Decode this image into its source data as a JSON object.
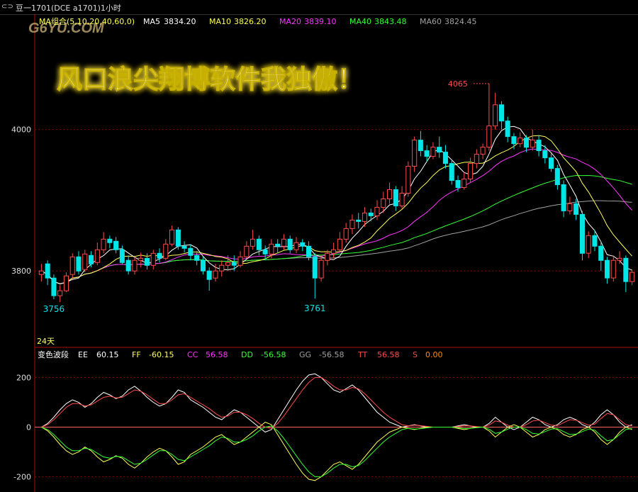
{
  "window": {
    "title": "豆一1701(DCE a1701)1小时"
  },
  "watermark": "G6YU.COM",
  "banner": "风口浪尖翔博软件我独傲！",
  "colors": {
    "up": "#ff4a4a",
    "down": "#00e5e5",
    "ma5": "#ffffff",
    "ma10": "#ffff55",
    "ma20": "#ff33ff",
    "ma40": "#33ff33",
    "ma60": "#a0a0a0",
    "grid": "#8a0000"
  },
  "price_panel": {
    "indicator_name": "MA组合(5,10,20,40,60,0)",
    "ma": [
      {
        "label": "MA5",
        "value": "3834.20",
        "color": "#ffffff"
      },
      {
        "label": "MA10",
        "value": "3826.20",
        "color": "#ffff55"
      },
      {
        "label": "MA20",
        "value": "3839.10",
        "color": "#ff33ff"
      },
      {
        "label": "MA40",
        "value": "3843.48",
        "color": "#33ff33"
      },
      {
        "label": "MA60",
        "value": "3824.45",
        "color": "#a0a0a0"
      }
    ],
    "period_label": "24天"
  },
  "indicator_panel": {
    "name": "变色波段",
    "values": [
      {
        "label": "EE",
        "value": "60.15",
        "label_color": "#ffffff",
        "value_color": "#ffffff"
      },
      {
        "label": "FF",
        "value": "-60.15",
        "label_color": "#ffff55",
        "value_color": "#ffff55"
      },
      {
        "label": "CC",
        "value": "56.58",
        "label_color": "#ff33ff",
        "value_color": "#ff33ff"
      },
      {
        "label": "DD",
        "value": "-56.58",
        "label_color": "#33ff33",
        "value_color": "#33ff33"
      },
      {
        "label": "GG",
        "value": "-56.58",
        "label_color": "#a0a0a0",
        "value_color": "#a0a0a0"
      },
      {
        "label": "TT",
        "value": "56.58",
        "label_color": "#ff4a4a",
        "value_color": "#ff4a4a"
      },
      {
        "label": "S",
        "value": "0.00",
        "label_color": "#ff4a4a",
        "value_color": "#ff8800"
      }
    ]
  },
  "chart_data": [
    {
      "type": "candlestick",
      "title": "豆一1701(DCE a1701)1小时",
      "ylabel": "",
      "y_ticks": [
        3800,
        4000
      ],
      "ylim": [
        3712,
        4133
      ],
      "annotations": [
        {
          "text": "4065",
          "index": 72,
          "kind": "high"
        },
        {
          "text": "3756",
          "index": 2,
          "kind": "low"
        },
        {
          "text": "3761",
          "index": 44,
          "kind": "low"
        }
      ],
      "candles": [
        [
          3795,
          3800,
          3785,
          3810
        ],
        [
          3810,
          3790,
          3780,
          3815
        ],
        [
          3790,
          3765,
          3760,
          3795
        ],
        [
          3765,
          3772,
          3756,
          3780
        ],
        [
          3772,
          3793,
          3770,
          3798
        ],
        [
          3795,
          3820,
          3790,
          3825
        ],
        [
          3820,
          3800,
          3795,
          3828
        ],
        [
          3802,
          3824,
          3798,
          3830
        ],
        [
          3822,
          3810,
          3805,
          3828
        ],
        [
          3812,
          3830,
          3808,
          3840
        ],
        [
          3830,
          3845,
          3825,
          3855
        ],
        [
          3845,
          3840,
          3832,
          3850
        ],
        [
          3842,
          3830,
          3825,
          3848
        ],
        [
          3830,
          3812,
          3810,
          3836
        ],
        [
          3815,
          3800,
          3795,
          3822
        ],
        [
          3800,
          3815,
          3795,
          3820
        ],
        [
          3815,
          3818,
          3805,
          3826
        ],
        [
          3818,
          3808,
          3802,
          3825
        ],
        [
          3808,
          3825,
          3802,
          3830
        ],
        [
          3825,
          3818,
          3812,
          3832
        ],
        [
          3818,
          3838,
          3815,
          3845
        ],
        [
          3838,
          3858,
          3835,
          3864
        ],
        [
          3858,
          3835,
          3830,
          3862
        ],
        [
          3835,
          3832,
          3826,
          3842
        ],
        [
          3832,
          3822,
          3815,
          3838
        ],
        [
          3822,
          3815,
          3808,
          3828
        ],
        [
          3815,
          3800,
          3795,
          3820
        ],
        [
          3800,
          3788,
          3772,
          3805
        ],
        [
          3790,
          3800,
          3785,
          3810
        ],
        [
          3800,
          3808,
          3792,
          3815
        ],
        [
          3808,
          3812,
          3800,
          3822
        ],
        [
          3812,
          3808,
          3800,
          3822
        ],
        [
          3808,
          3820,
          3805,
          3828
        ],
        [
          3820,
          3835,
          3818,
          3842
        ],
        [
          3835,
          3845,
          3830,
          3858
        ],
        [
          3845,
          3830,
          3822,
          3850
        ],
        [
          3830,
          3824,
          3815,
          3836
        ],
        [
          3824,
          3838,
          3818,
          3845
        ],
        [
          3838,
          3835,
          3825,
          3845
        ],
        [
          3835,
          3845,
          3830,
          3852
        ],
        [
          3845,
          3830,
          3825,
          3850
        ],
        [
          3830,
          3840,
          3825,
          3848
        ],
        [
          3840,
          3835,
          3828,
          3845
        ],
        [
          3835,
          3820,
          3815,
          3842
        ],
        [
          3820,
          3790,
          3761,
          3825
        ],
        [
          3790,
          3815,
          3785,
          3822
        ],
        [
          3815,
          3825,
          3808,
          3830
        ],
        [
          3825,
          3830,
          3818,
          3840
        ],
        [
          3830,
          3845,
          3826,
          3855
        ],
        [
          3845,
          3860,
          3840,
          3868
        ],
        [
          3860,
          3872,
          3852,
          3880
        ],
        [
          3872,
          3870,
          3860,
          3882
        ],
        [
          3870,
          3882,
          3862,
          3890
        ],
        [
          3882,
          3878,
          3870,
          3888
        ],
        [
          3878,
          3890,
          3872,
          3900
        ],
        [
          3890,
          3902,
          3882,
          3912
        ],
        [
          3902,
          3915,
          3895,
          3925
        ],
        [
          3915,
          3892,
          3885,
          3920
        ],
        [
          3892,
          3910,
          3888,
          3920
        ],
        [
          3910,
          3948,
          3905,
          3955
        ],
        [
          3948,
          3985,
          3940,
          3990
        ],
        [
          3985,
          3970,
          3962,
          3998
        ],
        [
          3970,
          3962,
          3955,
          3978
        ],
        [
          3962,
          3975,
          3958,
          3982
        ],
        [
          3975,
          3968,
          3960,
          3990
        ],
        [
          3968,
          3952,
          3945,
          3978
        ],
        [
          3952,
          3928,
          3922,
          3958
        ],
        [
          3928,
          3918,
          3912,
          3935
        ],
        [
          3918,
          3930,
          3915,
          3940
        ],
        [
          3930,
          3952,
          3925,
          3960
        ],
        [
          3952,
          3965,
          3945,
          3972
        ],
        [
          3965,
          3975,
          3958,
          3980
        ],
        [
          3975,
          4005,
          3970,
          4065
        ],
        [
          4005,
          4035,
          4000,
          4052
        ],
        [
          4035,
          4012,
          4000,
          4040
        ],
        [
          4012,
          3990,
          3982,
          4018
        ],
        [
          3990,
          3980,
          3972,
          3995
        ],
        [
          3980,
          3988,
          3975,
          3996
        ],
        [
          3988,
          3975,
          3968,
          3992
        ],
        [
          3975,
          3985,
          3970,
          4000
        ],
        [
          3985,
          3970,
          3962,
          3992
        ],
        [
          3970,
          3960,
          3952,
          3978
        ],
        [
          3960,
          3945,
          3940,
          3966
        ],
        [
          3945,
          3922,
          3915,
          3950
        ],
        [
          3922,
          3885,
          3876,
          3928
        ],
        [
          3885,
          3895,
          3880,
          3905
        ],
        [
          3895,
          3880,
          3872,
          3902
        ],
        [
          3880,
          3825,
          3815,
          3885
        ],
        [
          3825,
          3850,
          3818,
          3856
        ],
        [
          3850,
          3835,
          3828,
          3858
        ],
        [
          3835,
          3815,
          3800,
          3842
        ],
        [
          3815,
          3790,
          3782,
          3820
        ],
        [
          3790,
          3815,
          3785,
          3822
        ],
        [
          3815,
          3818,
          3810,
          3828
        ],
        [
          3818,
          3785,
          3770,
          3822
        ],
        [
          3785,
          3798,
          3780,
          3802
        ]
      ]
    },
    {
      "type": "line",
      "title": "变色波段",
      "y_ticks": [
        -200,
        0,
        200
      ],
      "ylim": [
        -250,
        250
      ],
      "series": [
        {
          "name": "EE",
          "color": "#ffffff",
          "values": [
            0,
            15,
            40,
            70,
            95,
            110,
            100,
            80,
            95,
            120,
            140,
            130,
            115,
            125,
            150,
            165,
            145,
            120,
            100,
            85,
            95,
            120,
            150,
            140,
            110,
            95,
            80,
            60,
            40,
            30,
            50,
            70,
            60,
            40,
            20,
            0,
            -20,
            -10,
            30,
            70,
            110,
            150,
            185,
            210,
            215,
            200,
            175,
            150,
            140,
            155,
            170,
            150,
            120,
            90,
            60,
            40,
            20,
            10,
            0,
            5,
            10,
            5,
            0,
            0,
            0,
            0,
            0,
            5,
            10,
            5,
            0,
            0,
            15,
            40,
            20,
            0,
            -10,
            0,
            20,
            40,
            30,
            10,
            0,
            10,
            30,
            40,
            30,
            10,
            0,
            20,
            50,
            70,
            50,
            20,
            0,
            10
          ]
        },
        {
          "name": "CC",
          "color": "#ff4a4a",
          "values": [
            0,
            10,
            30,
            55,
            80,
            95,
            95,
            85,
            90,
            105,
            120,
            125,
            118,
            120,
            135,
            150,
            145,
            130,
            112,
            95,
            95,
            110,
            130,
            135,
            120,
            105,
            90,
            75,
            55,
            40,
            45,
            60,
            60,
            50,
            35,
            15,
            0,
            -5,
            15,
            45,
            80,
            115,
            150,
            180,
            200,
            200,
            185,
            165,
            150,
            150,
            160,
            155,
            135,
            110,
            85,
            60,
            40,
            25,
            10,
            5,
            8,
            6,
            3,
            0,
            0,
            0,
            0,
            2,
            6,
            5,
            2,
            0,
            8,
            25,
            20,
            8,
            0,
            0,
            10,
            25,
            28,
            18,
            8,
            6,
            18,
            30,
            28,
            18,
            8,
            12,
            35,
            55,
            50,
            30,
            10,
            5
          ]
        },
        {
          "name": "FF",
          "color": "#ffff55",
          "values": [
            0,
            -15,
            -40,
            -70,
            -95,
            -110,
            -100,
            -80,
            -95,
            -120,
            -140,
            -130,
            -115,
            -125,
            -150,
            -165,
            -145,
            -120,
            -100,
            -85,
            -95,
            -120,
            -150,
            -140,
            -110,
            -95,
            -80,
            -60,
            -40,
            -30,
            -50,
            -70,
            -60,
            -40,
            -20,
            0,
            20,
            10,
            -30,
            -70,
            -110,
            -150,
            -185,
            -210,
            -215,
            -200,
            -175,
            -150,
            -140,
            -155,
            -170,
            -150,
            -120,
            -90,
            -60,
            -40,
            -20,
            -10,
            0,
            -5,
            -10,
            -5,
            0,
            0,
            0,
            0,
            0,
            -5,
            -10,
            -5,
            0,
            0,
            -15,
            -40,
            -20,
            0,
            10,
            0,
            -20,
            -40,
            -30,
            -10,
            0,
            -10,
            -30,
            -40,
            -30,
            -10,
            0,
            -20,
            -50,
            -70,
            -50,
            -20,
            0,
            -10
          ]
        },
        {
          "name": "DD",
          "color": "#33ff33",
          "values": [
            0,
            -10,
            -30,
            -55,
            -80,
            -95,
            -95,
            -85,
            -90,
            -105,
            -120,
            -125,
            -118,
            -120,
            -135,
            -150,
            -145,
            -130,
            -112,
            -95,
            -95,
            -110,
            -130,
            -135,
            -120,
            -105,
            -90,
            -75,
            -55,
            -40,
            -45,
            -60,
            -60,
            -50,
            -35,
            -15,
            0,
            5,
            -15,
            -45,
            -80,
            -115,
            -150,
            -180,
            -200,
            -200,
            -185,
            -165,
            -150,
            -150,
            -160,
            -155,
            -135,
            -110,
            -85,
            -60,
            -40,
            -25,
            -10,
            -5,
            -8,
            -6,
            -3,
            0,
            0,
            0,
            0,
            -2,
            -6,
            -5,
            -2,
            0,
            -8,
            -25,
            -20,
            -8,
            0,
            0,
            -10,
            -25,
            -28,
            -18,
            -8,
            -6,
            -18,
            -30,
            -28,
            -18,
            -8,
            -12,
            -35,
            -55,
            -50,
            -30,
            -10,
            -5
          ]
        }
      ]
    }
  ]
}
